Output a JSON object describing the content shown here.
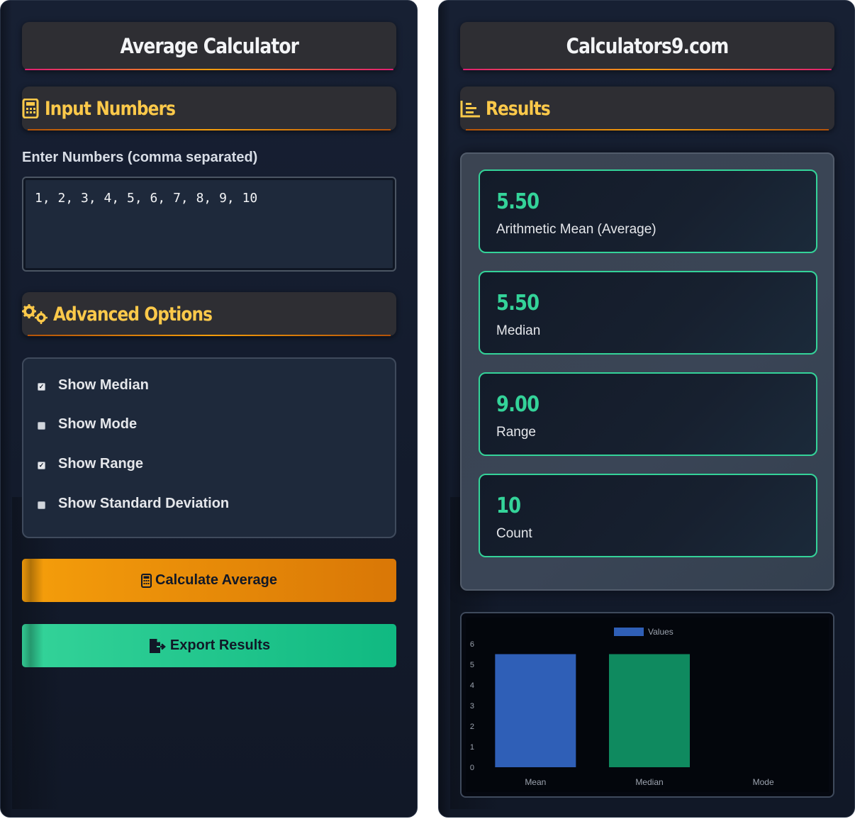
{
  "left_panel": {
    "title": "Average Calculator",
    "input_section": {
      "title": "Input Numbers",
      "icon": "calculator-icon"
    },
    "numbers_field": {
      "label": "Enter Numbers (comma separated)",
      "value": "1, 2, 3, 4, 5, 6, 7, 8, 9, 10"
    },
    "advanced_section": {
      "title": "Advanced Options",
      "icon": "gears-icon"
    },
    "options": [
      {
        "label": "Show Median",
        "checked": true
      },
      {
        "label": "Show Mode",
        "checked": false
      },
      {
        "label": "Show Range",
        "checked": true
      },
      {
        "label": "Show Standard Deviation",
        "checked": false
      }
    ],
    "calculate_button": {
      "label": "Calculate Average",
      "icon": "calculator-icon",
      "color": "#f59e0b"
    },
    "export_button": {
      "label": "Export Results",
      "icon": "file-export-icon",
      "color": "#34d399"
    }
  },
  "right_panel": {
    "title": "Calculators9.com",
    "results_section": {
      "title": "Results",
      "icon": "bar-chart-icon"
    },
    "results": [
      {
        "value": "5.50",
        "label": "Arithmetic Mean (Average)"
      },
      {
        "value": "5.50",
        "label": "Median"
      },
      {
        "value": "9.00",
        "label": "Range"
      },
      {
        "value": "10",
        "label": "Count"
      }
    ]
  },
  "colors": {
    "accent_yellow": "#fcc94a",
    "accent_green": "#34d399",
    "panel_bg": "#172033"
  },
  "chart_data": {
    "type": "bar",
    "categories": [
      "Mean",
      "Median",
      "Mode"
    ],
    "series": [
      {
        "name": "Values",
        "values": [
          5.5,
          5.5,
          null
        ],
        "colors": [
          "#2f5fb7",
          "#0f8a5f",
          "#0f8a5f"
        ]
      }
    ],
    "yticks": [
      "0",
      "1",
      "2",
      "3",
      "4",
      "5",
      "6"
    ],
    "ylim": [
      0,
      6
    ],
    "legend": "top-center",
    "grid": false
  }
}
